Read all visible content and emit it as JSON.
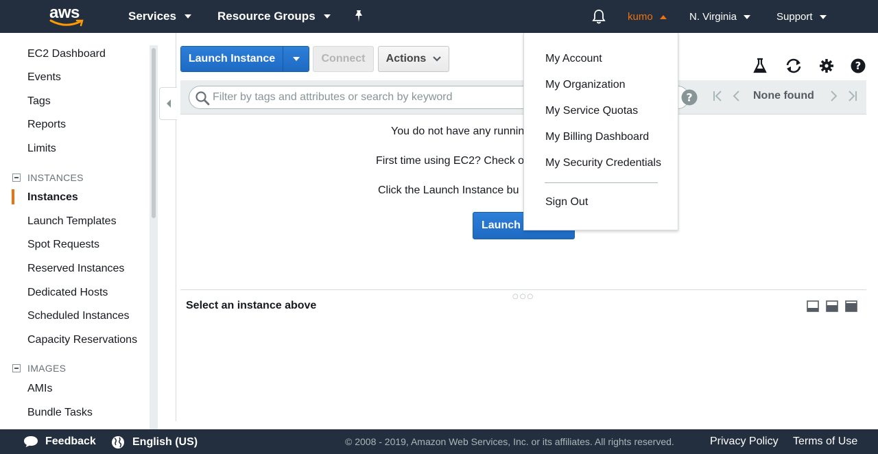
{
  "topnav": {
    "logo": "aws",
    "services": "Services",
    "resource_groups": "Resource Groups",
    "user": "kumo",
    "region": "N. Virginia",
    "support": "Support"
  },
  "sidebar": {
    "items_top": [
      "EC2 Dashboard",
      "Events",
      "Tags",
      "Reports",
      "Limits"
    ],
    "section_instances": "INSTANCES",
    "items_instances": [
      "Instances",
      "Launch Templates",
      "Spot Requests",
      "Reserved Instances",
      "Dedicated Hosts",
      "Scheduled Instances",
      "Capacity Reservations"
    ],
    "section_images": "IMAGES",
    "items_images": [
      "AMIs",
      "Bundle Tasks"
    ]
  },
  "toolbar": {
    "launch_label": "Launch Instance",
    "connect_label": "Connect",
    "actions_label": "Actions"
  },
  "filter": {
    "placeholder": "Filter by tags and attributes or search by keyword",
    "pager_text": "None found"
  },
  "empty": {
    "line1": "You do not have any runnin",
    "line2": "First time using EC2? Check o",
    "line3": "Click the Launch Instance bu",
    "launch_button": "Launch I"
  },
  "detail": {
    "title": "Select an instance above"
  },
  "account_menu": {
    "items": [
      "My Account",
      "My Organization",
      "My Service Quotas",
      "My Billing Dashboard",
      "My Security Credentials"
    ],
    "sign_out": "Sign Out"
  },
  "footer": {
    "feedback": "Feedback",
    "language": "English (US)",
    "copyright": "© 2008 - 2019, Amazon Web Services, Inc. or its affiliates. All rights reserved.",
    "privacy": "Privacy Policy",
    "terms": "Terms of Use"
  },
  "colors": {
    "nav_bg": "#232f3e",
    "accent_orange": "#ec7211",
    "primary_blue": "#1e6ac3"
  }
}
